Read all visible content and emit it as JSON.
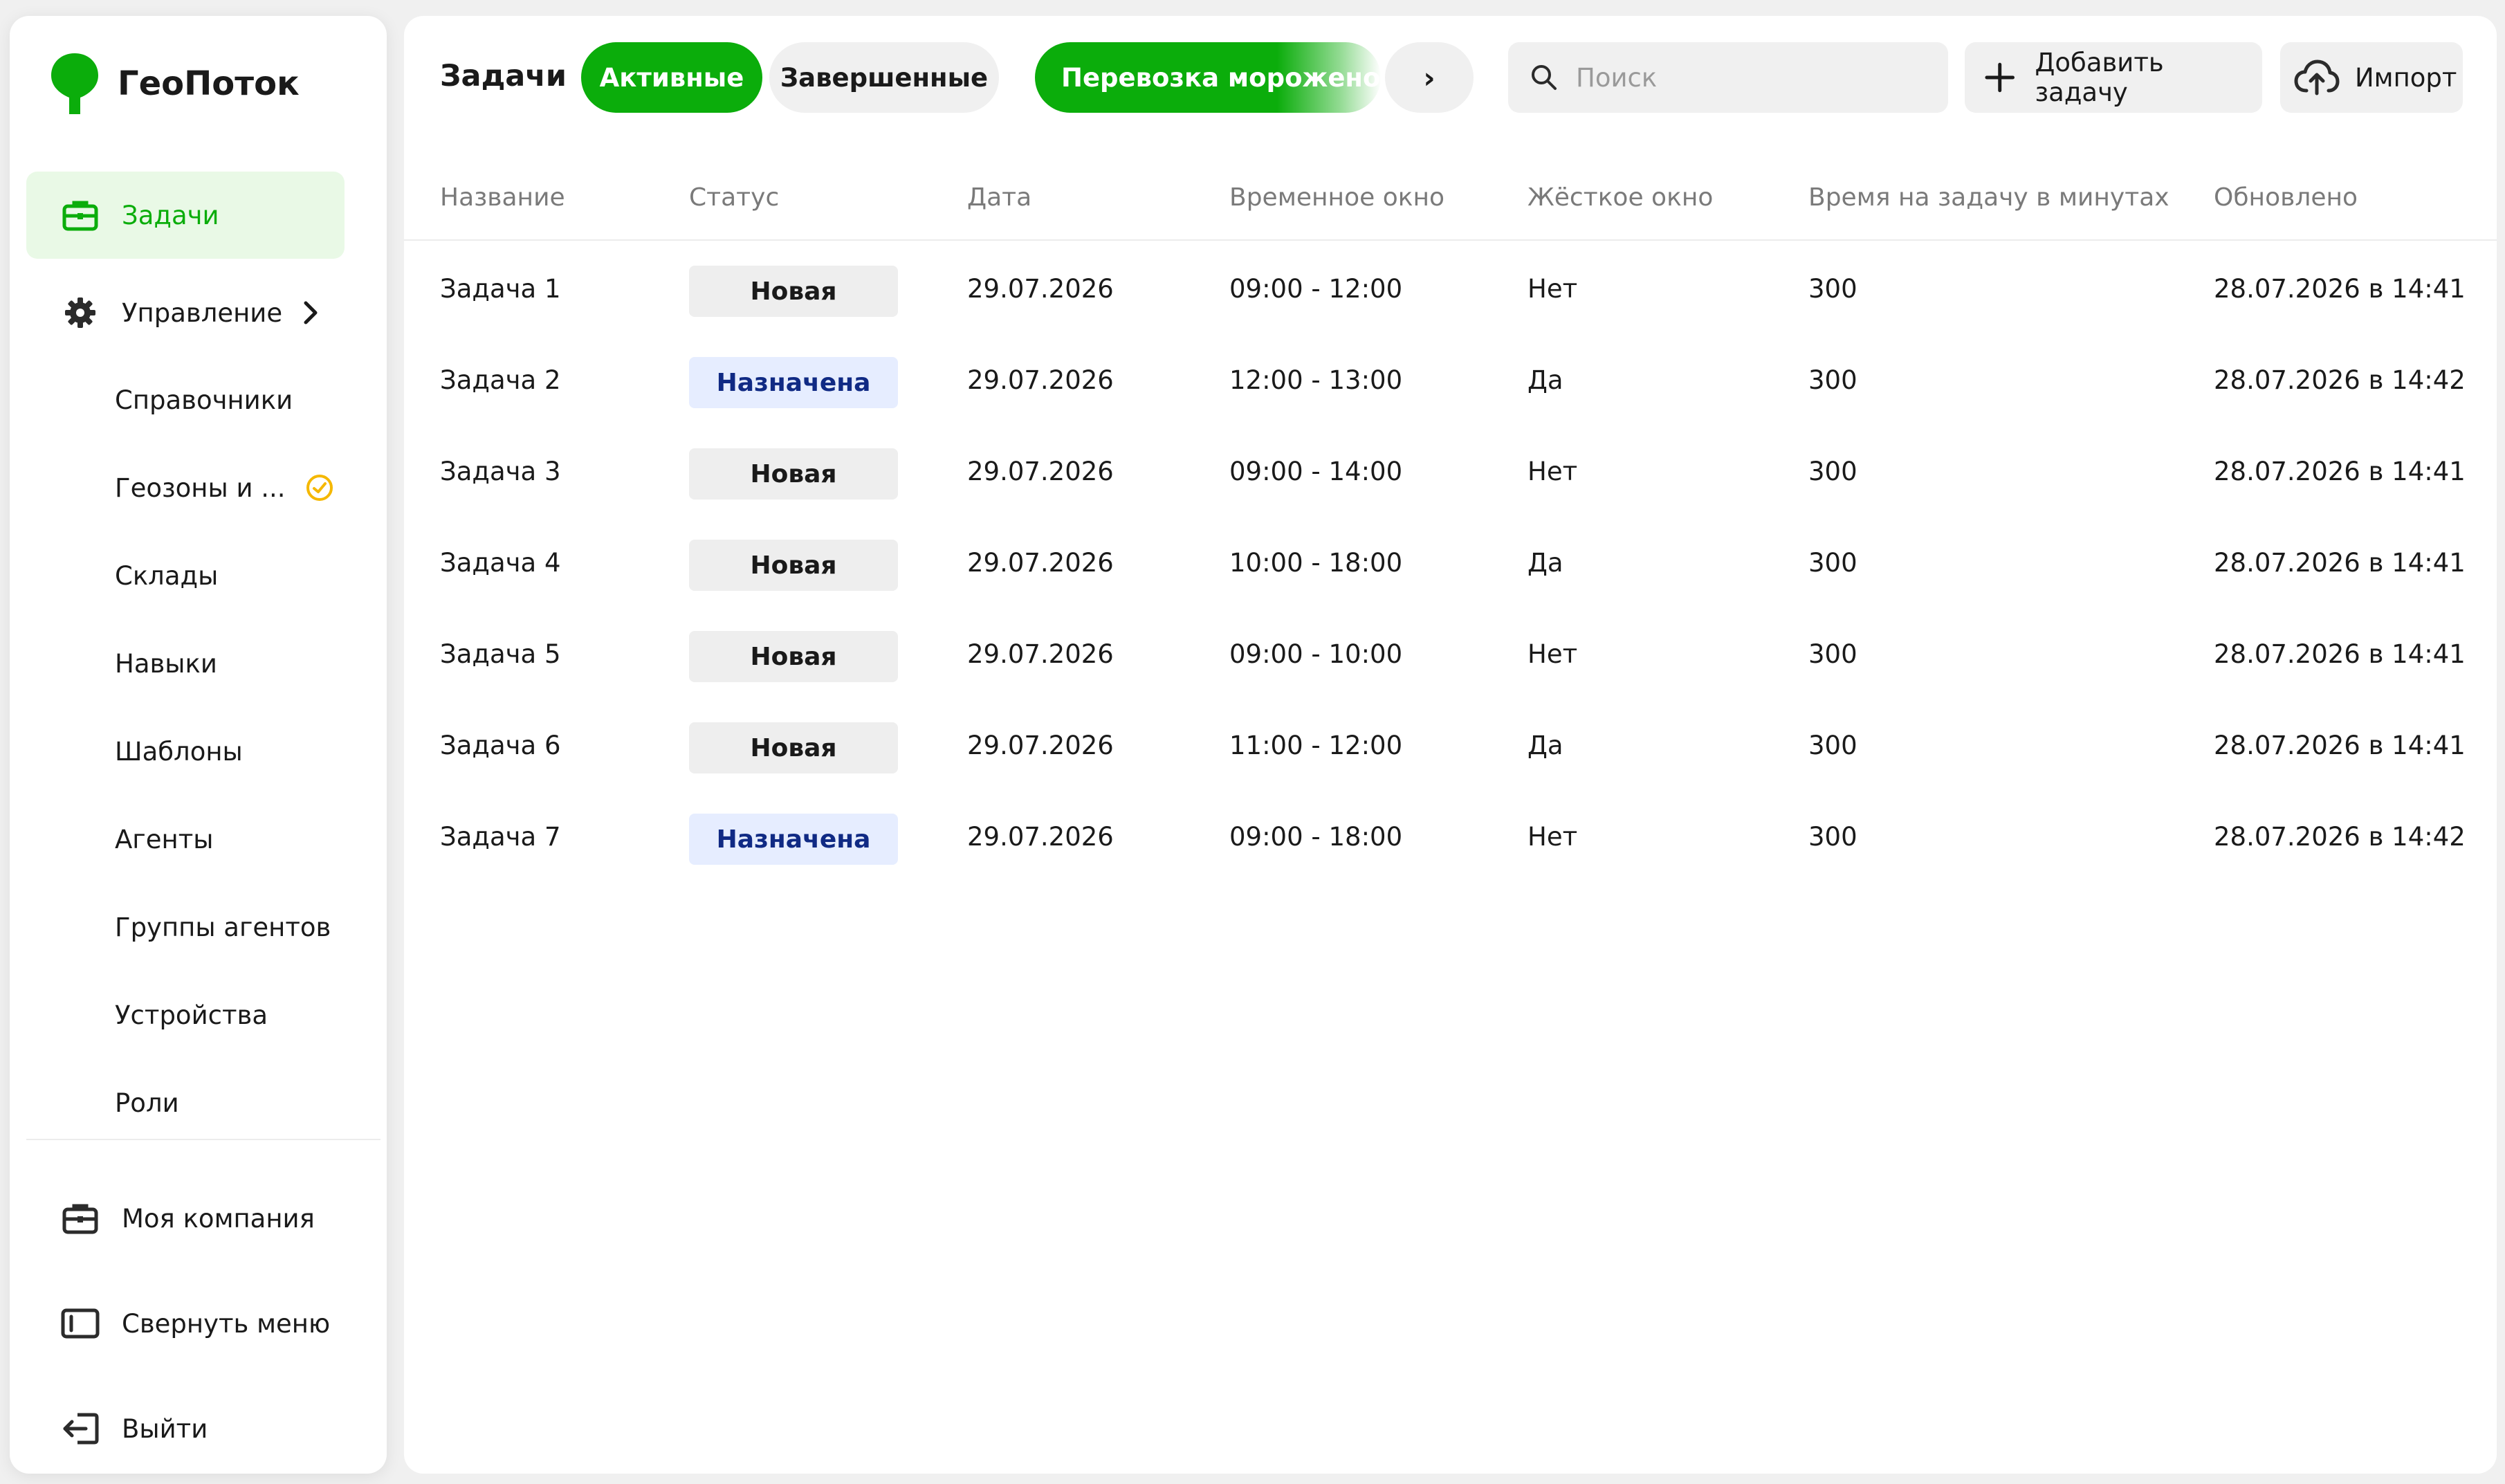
{
  "brand": {
    "name": "ГеоПоток",
    "color": "#0bad0b"
  },
  "sidebar": {
    "items": [
      {
        "label": "Задачи",
        "icon": "briefcase-icon",
        "active": true
      },
      {
        "label": "Управление",
        "icon": "gear-icon"
      }
    ],
    "sub_items": [
      {
        "label": "Справочники"
      },
      {
        "label": "Геозоны и ...",
        "badge_icon": "pending-clock-icon"
      },
      {
        "label": "Склады"
      },
      {
        "label": "Навыки"
      },
      {
        "label": "Шаблоны"
      },
      {
        "label": "Агенты"
      },
      {
        "label": "Группы агентов"
      },
      {
        "label": "Устройства"
      },
      {
        "label": "Роли"
      }
    ],
    "footer": [
      {
        "label": "Моя компания",
        "icon": "briefcase-icon"
      },
      {
        "label": "Свернуть меню",
        "icon": "collapse-sidebar-icon"
      },
      {
        "label": "Выйти",
        "icon": "logout-icon"
      }
    ]
  },
  "header": {
    "title": "Задачи",
    "filters": {
      "active": "Активные",
      "done": "Завершенные",
      "route": "Перевозка мороженого",
      "more": "›"
    },
    "search": {
      "placeholder": "Поиск",
      "value": ""
    },
    "add_label": "Добавить задачу",
    "import_label": "Импорт"
  },
  "table": {
    "columns": [
      "Название",
      "Статус",
      "Дата",
      "Временное окно",
      "Жёсткое окно",
      "Время на задачу в минутах",
      "Обновлено"
    ],
    "rows": [
      {
        "name": "Задача 1",
        "status": "Новая",
        "status_kind": "new",
        "date": "29.07.2026",
        "window": "09:00 - 12:00",
        "hard": "Нет",
        "minutes": "300",
        "updated": "28.07.2026 в 14:41"
      },
      {
        "name": "Задача 2",
        "status": "Назначена",
        "status_kind": "assigned",
        "date": "29.07.2026",
        "window": "12:00 - 13:00",
        "hard": "Да",
        "minutes": "300",
        "updated": "28.07.2026 в 14:42"
      },
      {
        "name": "Задача 3",
        "status": "Новая",
        "status_kind": "new",
        "date": "29.07.2026",
        "window": "09:00 - 14:00",
        "hard": "Нет",
        "minutes": "300",
        "updated": "28.07.2026 в 14:41"
      },
      {
        "name": "Задача 4",
        "status": "Новая",
        "status_kind": "new",
        "date": "29.07.2026",
        "window": "10:00 - 18:00",
        "hard": "Да",
        "minutes": "300",
        "updated": "28.07.2026 в 14:41"
      },
      {
        "name": "Задача 5",
        "status": "Новая",
        "status_kind": "new",
        "date": "29.07.2026",
        "window": "09:00 - 10:00",
        "hard": "Нет",
        "minutes": "300",
        "updated": "28.07.2026 в 14:41"
      },
      {
        "name": "Задача 6",
        "status": "Новая",
        "status_kind": "new",
        "date": "29.07.2026",
        "window": "11:00 - 12:00",
        "hard": "Да",
        "minutes": "300",
        "updated": "28.07.2026 в 14:41"
      },
      {
        "name": "Задача 7",
        "status": "Назначена",
        "status_kind": "assigned",
        "date": "29.07.2026",
        "window": "09:00 - 18:00",
        "hard": "Нет",
        "minutes": "300",
        "updated": "28.07.2026 в 14:42"
      }
    ]
  }
}
